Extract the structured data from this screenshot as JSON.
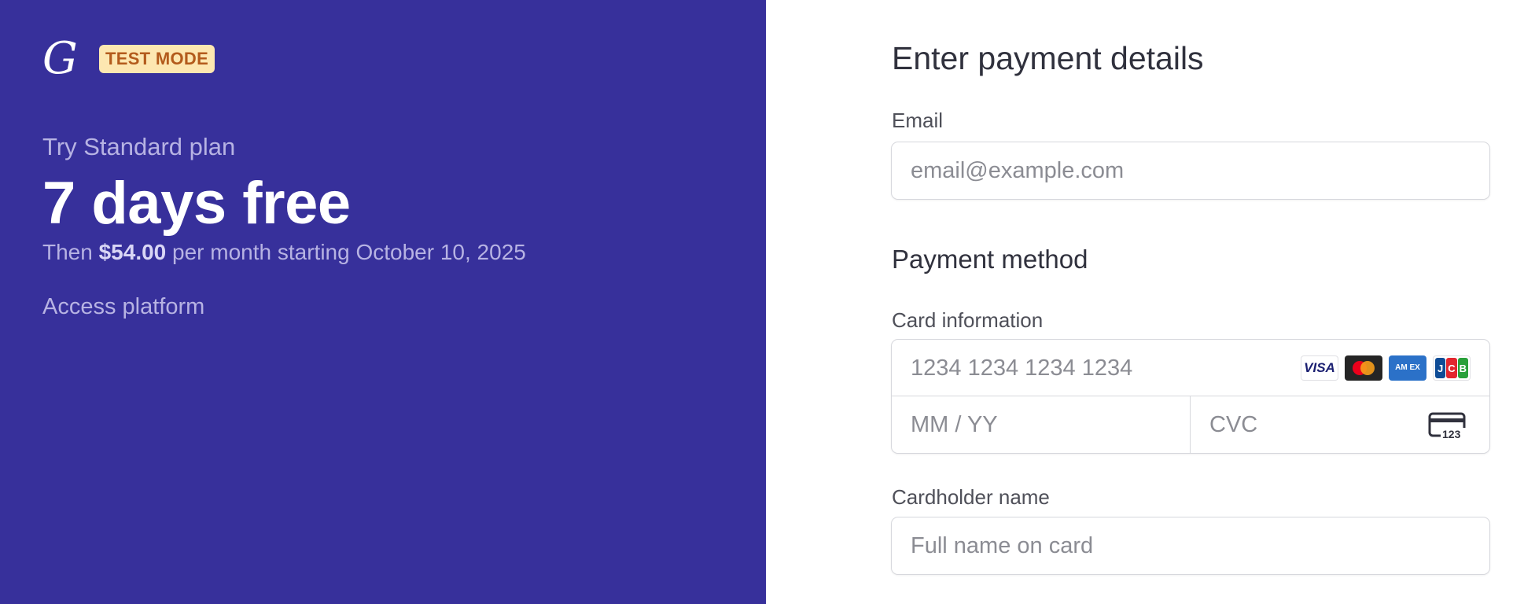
{
  "header": {
    "logo_letter": "G",
    "badge_label": "TEST MODE"
  },
  "plan": {
    "subtitle": "Try Standard plan",
    "title": "7 days free",
    "price_prefix": "Then",
    "price_amount": "$54.00",
    "price_suffix": "per month starting October 10, 2025",
    "access_label": "Access platform"
  },
  "form": {
    "title": "Enter payment details",
    "email": {
      "label": "Email",
      "placeholder": "email@example.com"
    },
    "payment_method_title": "Payment method",
    "card": {
      "label": "Card information",
      "number_placeholder": "1234 1234 1234 1234",
      "expiry_placeholder": "MM / YY",
      "cvc_placeholder": "CVC",
      "cvc_icon_text": "123",
      "brands": [
        {
          "name": "visa-icon",
          "label": "VISA"
        },
        {
          "name": "mastercard-icon",
          "label": ""
        },
        {
          "name": "amex-icon",
          "label": "AM EX"
        },
        {
          "name": "jcb-icon",
          "label": "JCB"
        }
      ]
    },
    "cardholder": {
      "label": "Cardholder name",
      "placeholder": "Full name on card"
    }
  },
  "colors": {
    "left_panel_bg": "#37309b",
    "badge_bg": "#fde7b1",
    "badge_text": "#b35b1c",
    "visa": "#1a1f71",
    "amex": "#2b71c8"
  }
}
